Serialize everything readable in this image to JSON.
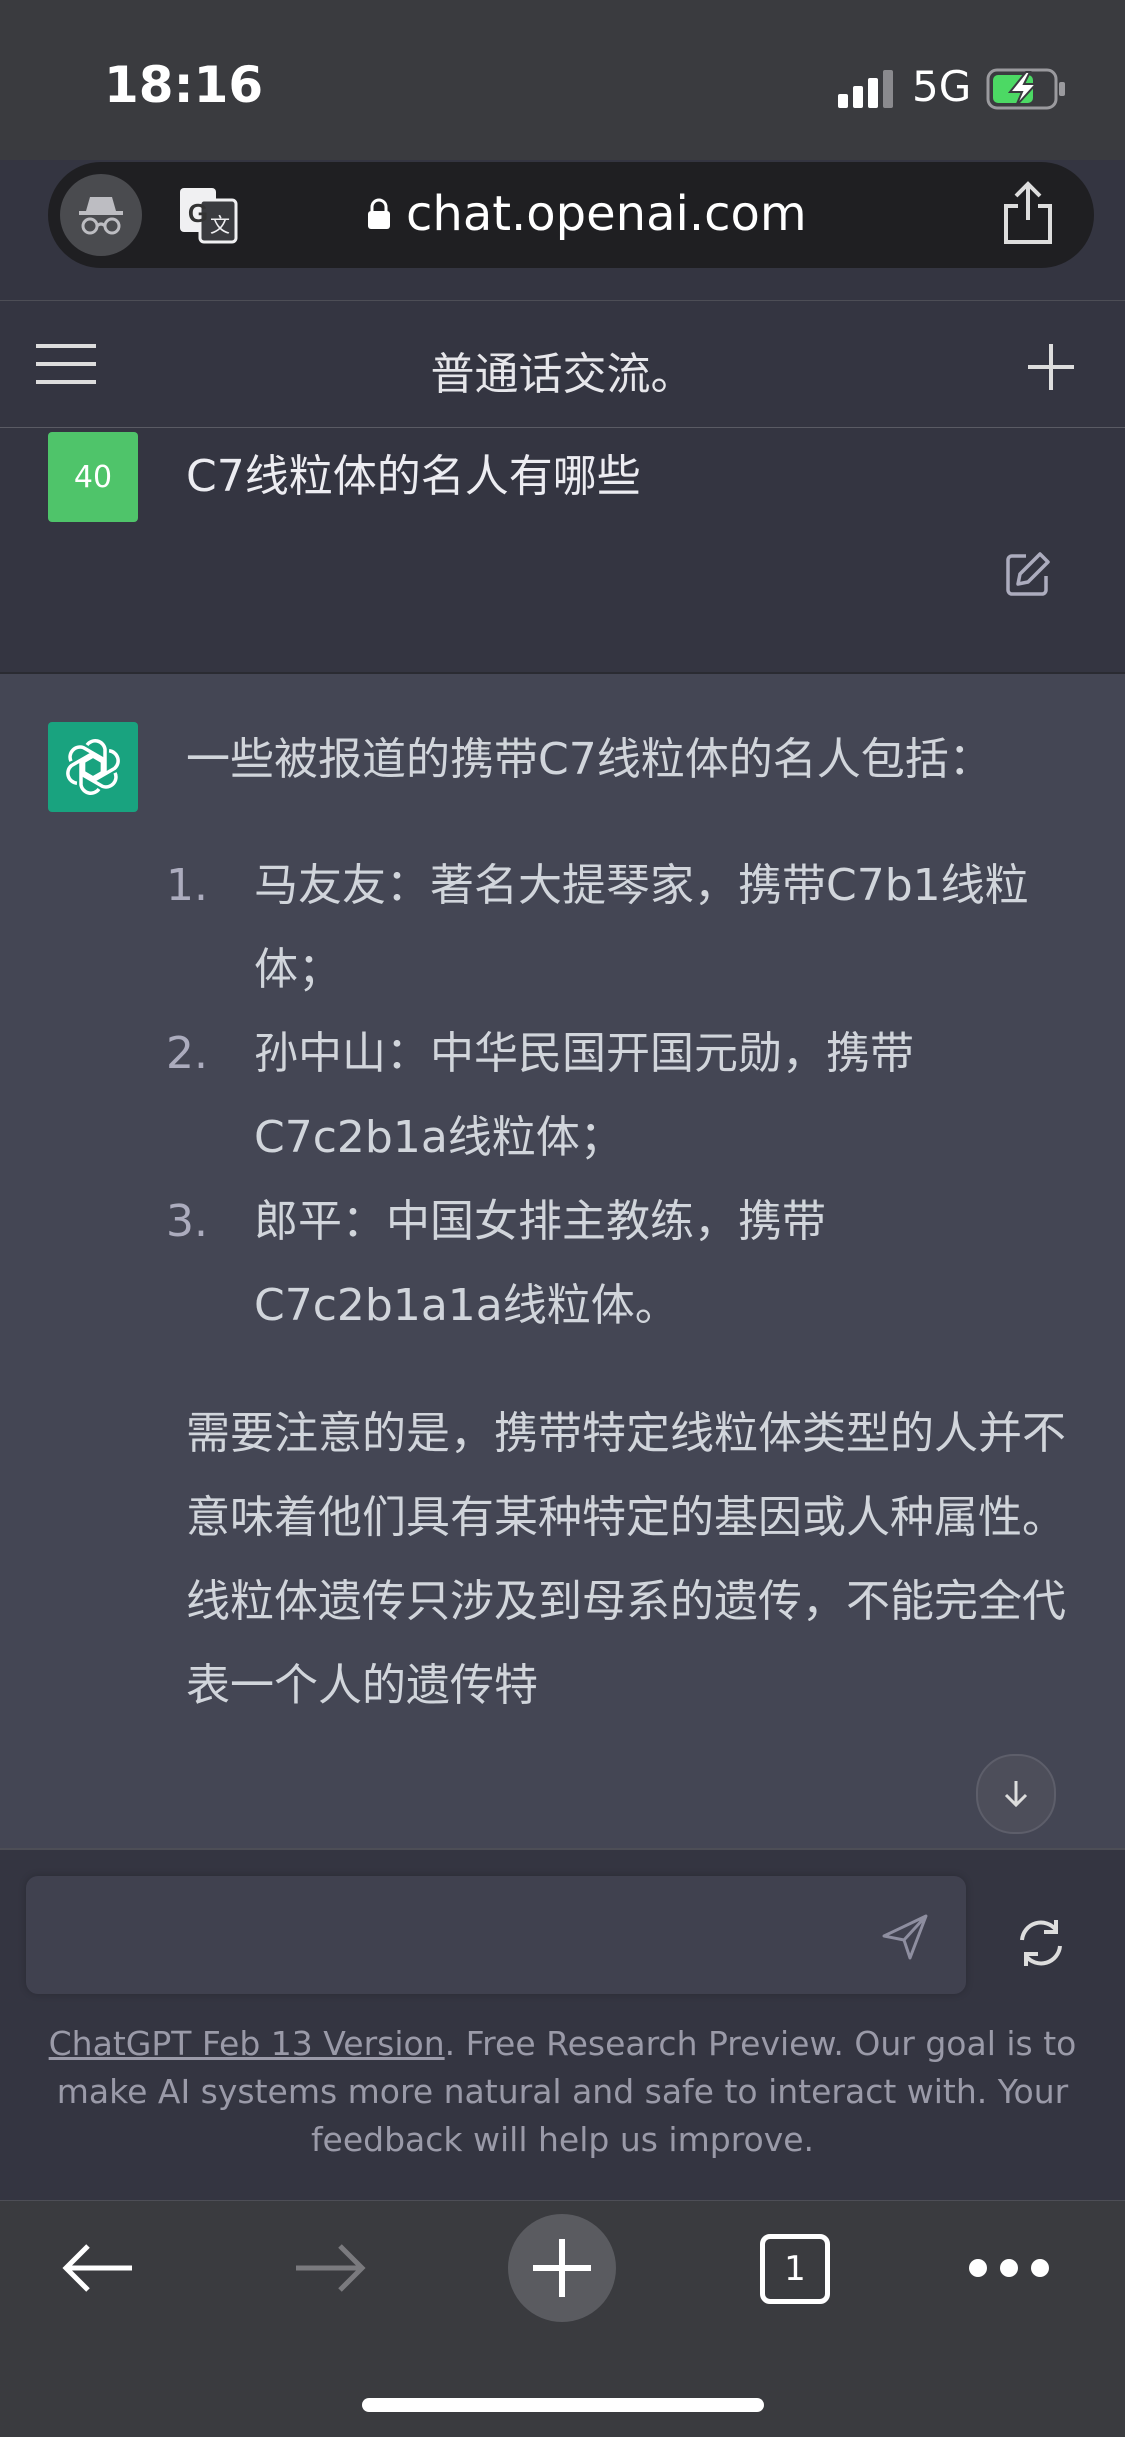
{
  "status_bar": {
    "time": "18:16",
    "network": "5G"
  },
  "browser": {
    "url": "chat.openai.com",
    "tab_count": "1"
  },
  "chat": {
    "title": "普通话交流。",
    "user": {
      "avatar_text": "40",
      "message": "C7线粒体的名人有哪些"
    },
    "assistant": {
      "intro": "一些被报道的携带C7线粒体的名人包括：",
      "items": [
        {
          "num": "1.",
          "text": "马友友：著名大提琴家，携带C7b1线粒体；"
        },
        {
          "num": "2.",
          "text": "孙中山：中华民国开国元勋，携带C7c2b1a线粒体；"
        },
        {
          "num": "3.",
          "text": "郎平：中国女排主教练，携带C7c2b1a1a线粒体。"
        }
      ],
      "note": "需要注意的是，携带特定线粒体类型的人并不意味着他们具有某种特定的基因或人种属性。线粒体遗传只涉及到母系的遗传，不能完全代表一个人的遗传特"
    }
  },
  "composer": {
    "placeholder": "",
    "footer_link": "ChatGPT Feb 13 Version",
    "footer_text": ". Free Research Preview. Our goal is to make AI systems more natural and safe to interact with. Your feedback will help us improve."
  },
  "colors": {
    "user_avatar": "#4fc46a",
    "gpt_avatar": "#19a37f",
    "assistant_bg": "#444654",
    "page_bg": "#343541"
  }
}
